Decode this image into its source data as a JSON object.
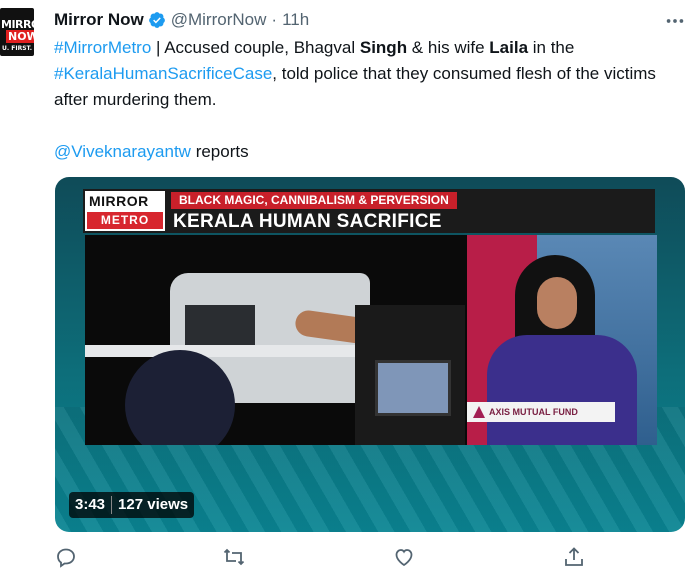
{
  "account": {
    "name": "Mirror Now",
    "handle": "@MirrorNow",
    "separator": "·",
    "time": "11h",
    "avatar_text_1": "MIRROR",
    "avatar_text_2": "NOW",
    "avatar_text_3": "U. FIRST."
  },
  "tweet": {
    "hashtag1": "#MirrorMetro",
    "text1": " | Accused couple, Bhagval ",
    "bold1": "Singh",
    "text2": " & his wife ",
    "bold2": "Laila",
    "text3": " in the",
    "hashtag2": "#KeralaHumanSacrificeCase",
    "text4": ", told police that they consumed flesh of the victims after murdering them.",
    "mention": "@Viveknarayantw",
    "text5": " reports"
  },
  "video": {
    "logo_top": "MIRROR",
    "logo_bottom": "METRO",
    "tag": "BLACK MAGIC, CANNIBALISM & PERVERSION",
    "headline": "KERALA HUMAN SACRIFICE",
    "sponsor": "AXIS MUTUAL FUND",
    "duration": "3:43",
    "views": "127 views"
  },
  "colors": {
    "link": "#1d9bf0",
    "muted": "#536471",
    "verified": "#1d9bf0"
  },
  "icons": [
    "verified-badge-icon",
    "more-icon",
    "reply-icon",
    "retweet-icon",
    "like-icon",
    "share-icon"
  ]
}
